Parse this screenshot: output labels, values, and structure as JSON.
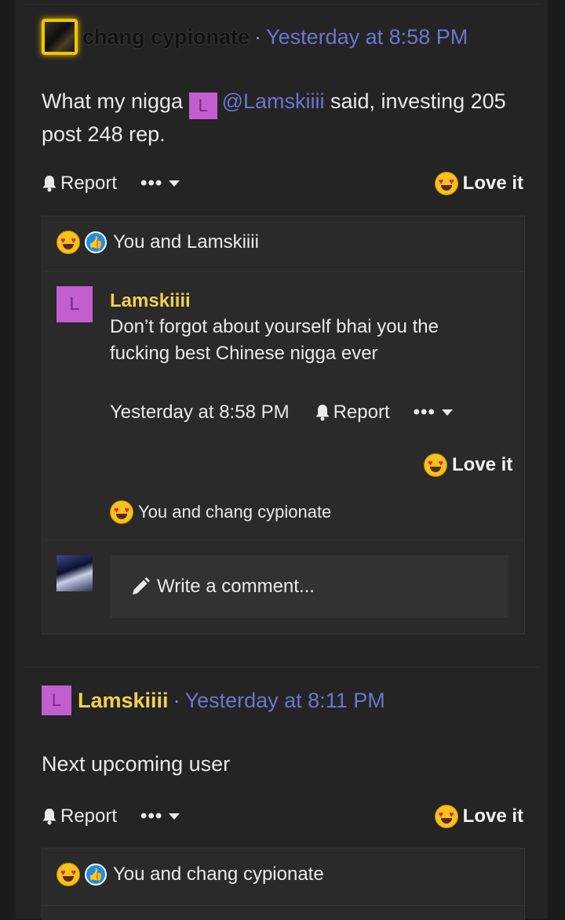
{
  "post1": {
    "username": "chang cypionate",
    "separator": "·",
    "time": "Yesterday at 8:58 PM",
    "text_before": "What my nigga ",
    "mention_letter": "L",
    "mention": "@Lamskiiii",
    "text_after": " said, investing 205 post 248 rep.",
    "report_label": "Report",
    "more_label": "•••",
    "love_label": "Love it",
    "reactions_text": "You and Lamskiiii",
    "comment": {
      "avatar_letter": "L",
      "username": "Lamskiiii",
      "text": "Don’t forgot about yourself bhai you the fucking best Chinese nigga ever",
      "time": "Yesterday at 8:58 PM",
      "report_label": "Report",
      "more_label": "•••",
      "love_label": "Love it",
      "reactions_text": "You and chang cypionate"
    },
    "write_placeholder": "Write a comment..."
  },
  "post2": {
    "avatar_letter": "L",
    "username": "Lamskiiii",
    "separator": "·",
    "time": "Yesterday at 8:11 PM",
    "text": "Next upcoming user",
    "report_label": "Report",
    "more_label": "•••",
    "love_label": "Love it",
    "reactions_text": "You and chang cypionate"
  },
  "icons": [
    "bell-icon",
    "more-icon",
    "caret-down-icon",
    "love-emoji-icon",
    "like-emoji-icon",
    "pencil-icon"
  ],
  "colors": {
    "accent_link": "#6c75d0",
    "username_yellow": "#f0d050",
    "avatar_purple": "#c25ed0",
    "background": "#242424"
  }
}
